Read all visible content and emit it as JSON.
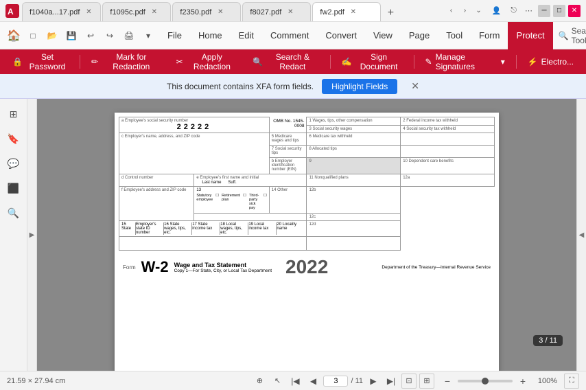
{
  "titlebar": {
    "tabs": [
      {
        "label": "f1040a...17.pdf",
        "active": false
      },
      {
        "label": "f1095c.pdf",
        "active": false
      },
      {
        "label": "f2350.pdf",
        "active": false
      },
      {
        "label": "f8027.pdf",
        "active": false
      },
      {
        "label": "fw2.pdf",
        "active": true
      }
    ],
    "add_tab_label": "+",
    "nav_back": "‹",
    "nav_fwd": "›"
  },
  "menubar": {
    "items": [
      "File",
      "Home",
      "Edit",
      "Comment",
      "Convert",
      "View",
      "Page",
      "Tool",
      "Form",
      "Protect"
    ],
    "active": "Protect",
    "search_tools": "Search Tools"
  },
  "toolbar": {
    "buttons": [
      {
        "label": "Set Password",
        "icon": "🔒"
      },
      {
        "label": "Mark for Redaction",
        "icon": "✏"
      },
      {
        "label": "Apply Redaction",
        "icon": "✂"
      },
      {
        "label": "Search & Redact",
        "icon": "🔍"
      },
      {
        "label": "Sign Document",
        "icon": "✍"
      },
      {
        "label": "Manage Signatures",
        "icon": "✎"
      },
      {
        "label": "Electro...",
        "icon": "⚡"
      }
    ]
  },
  "xfa_banner": {
    "message": "This document contains XFA form fields.",
    "button_label": "Highlight Fields"
  },
  "sidebar": {
    "icons": [
      {
        "name": "pages-icon",
        "glyph": "⊞"
      },
      {
        "name": "bookmarks-icon",
        "glyph": "🔖"
      },
      {
        "name": "comments-icon",
        "glyph": "💬"
      },
      {
        "name": "layers-icon",
        "glyph": "⬛"
      },
      {
        "name": "search-icon",
        "glyph": "🔍"
      }
    ]
  },
  "document": {
    "form_number": "22222",
    "omb": "OMB No. 1545-0008",
    "fields": {
      "a_label": "a  Employee's social security number",
      "b_label": "b  Employer identification number (EIN)",
      "c_label": "c  Employer's name, address, and ZIP code",
      "d_label": "d  Control number",
      "e_label": "e  Employee's first name and initial",
      "e_lastname": "Last name",
      "e_suff": "Suff.",
      "f_label": "f  Employee's address and ZIP code",
      "f1_label": "15 State",
      "f2_label": "Employer's state ID number",
      "f3_label": "16 State wages, tips, etc.",
      "f4_label": "17 State income tax",
      "f5_label": "18 Local wages, tips, etc.",
      "f6_label": "19 Local income tax",
      "f7_label": "20 Locality name",
      "r1_label": "1  Wages, tips, other compensation",
      "r2_label": "2  Federal income tax withheld",
      "r3_label": "3  Social security wages",
      "r4_label": "4  Social security tax withheld",
      "r5_label": "5  Medicare wages and tips",
      "r6_label": "6  Medicare tax withheld",
      "r7_label": "7  Social security tips",
      "r8_label": "8  Allocated tips",
      "r9_label": "9",
      "r10_label": "10  Dependent care benefits",
      "r11_label": "11  Nonqualified plans",
      "r12a_label": "12a",
      "r12b_label": "12b",
      "r12c_label": "12c",
      "r12d_label": "12d",
      "r13_label": "13",
      "r13_sub1": "Statutory employee",
      "r13_sub2": "Retirement plan",
      "r13_sub3": "Third-party sick pay",
      "r14_label": "14  Other"
    },
    "footer": {
      "form_label": "Form",
      "form_name": "W-2",
      "form_title": "Wage and Tax Statement",
      "year": "2022",
      "dept": "Department of the Treasury—Internal Revenue Service",
      "copy_note": "Copy 1—For State, City, or Local Tax Department"
    }
  },
  "statusbar": {
    "dimensions": "21.59 × 27.94 cm",
    "page_current": "3",
    "page_total": "11",
    "page_display": "3 / 11",
    "zoom_value": "100%"
  }
}
